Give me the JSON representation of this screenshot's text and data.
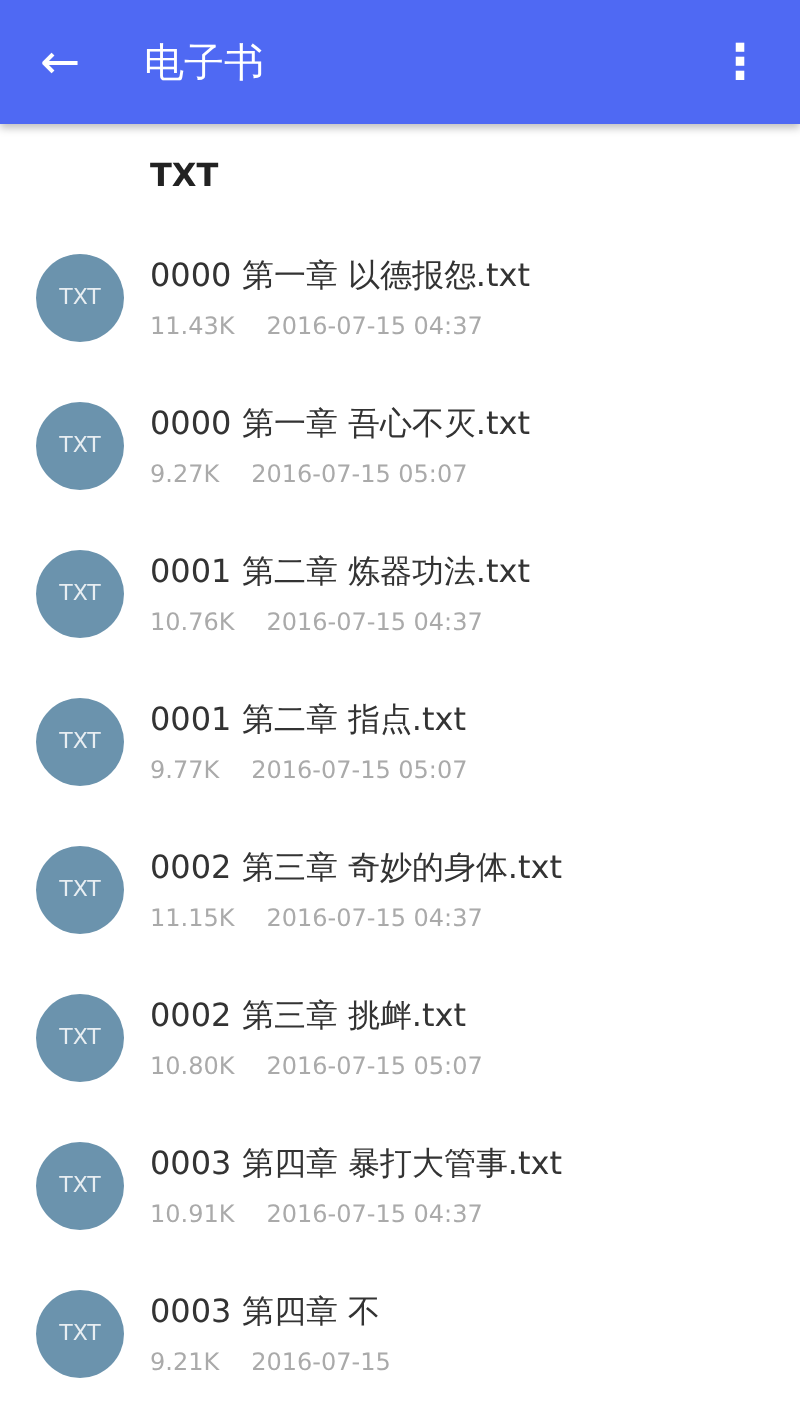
{
  "app_bar": {
    "back": "←",
    "title": "电子书",
    "menu": "⋮"
  },
  "section_header": "TXT",
  "files": [
    {
      "badge": "TXT",
      "name": "0000  第一章 以德报怨.txt",
      "size": "11.43K",
      "date": "2016-07-15 04:37"
    },
    {
      "badge": "TXT",
      "name": "0000 第一章 吾心不灭.txt",
      "size": "9.27K",
      "date": "2016-07-15 05:07"
    },
    {
      "badge": "TXT",
      "name": "0001  第二章 炼器功法.txt",
      "size": "10.76K",
      "date": "2016-07-15 04:37"
    },
    {
      "badge": "TXT",
      "name": "0001 第二章 指点.txt",
      "size": "9.77K",
      "date": "2016-07-15 05:07"
    },
    {
      "badge": "TXT",
      "name": "0002  第三章 奇妙的身体.txt",
      "size": "11.15K",
      "date": "2016-07-15 04:37"
    },
    {
      "badge": "TXT",
      "name": "0002 第三章 挑衅.txt",
      "size": "10.80K",
      "date": "2016-07-15 05:07"
    },
    {
      "badge": "TXT",
      "name": "0003  第四章 暴打大管事.txt",
      "size": "10.91K",
      "date": "2016-07-15 04:37"
    },
    {
      "badge": "TXT",
      "name": "0003 第四章 不",
      "size": "9.21K",
      "date": "2016-07-15"
    }
  ]
}
